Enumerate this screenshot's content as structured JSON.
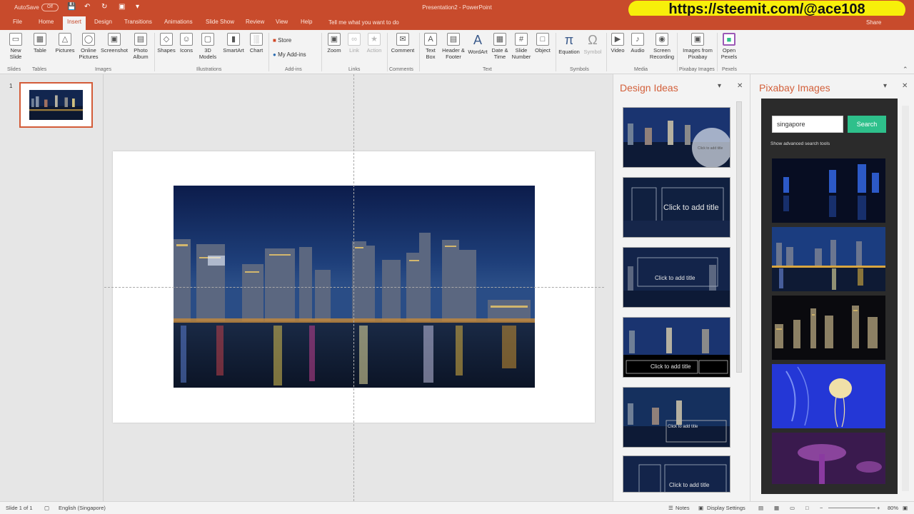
{
  "titlebar": {
    "autosave": "AutoSave",
    "toggle": "Off",
    "title": "Presentation2 - PowerPoint",
    "banner": "https://steemit.com/@ace108"
  },
  "tabs": [
    "File",
    "Home",
    "Insert",
    "Design",
    "Transitions",
    "Animations",
    "Slide Show",
    "Review",
    "View",
    "Help"
  ],
  "active_tab": "Insert",
  "tell_me": "Tell me what you want to do",
  "share": "Share",
  "ribbon": {
    "buttons": {
      "new_slide": "New Slide",
      "table": "Table",
      "pictures": "Pictures",
      "online_pictures": "Online Pictures",
      "screenshot": "Screenshot",
      "photo_album": "Photo Album",
      "shapes": "Shapes",
      "icons": "Icons",
      "models_3d": "3D Models",
      "smartart": "SmartArt",
      "chart": "Chart",
      "store": "Store",
      "my_addins": "My Add-ins",
      "zoom": "Zoom",
      "link": "Link",
      "action": "Action",
      "comment": "Comment",
      "text_box": "Text Box",
      "header_footer": "Header & Footer",
      "wordart": "WordArt",
      "date_time": "Date & Time",
      "slide_number": "Slide Number",
      "object": "Object",
      "equation": "Equation",
      "symbol": "Symbol",
      "video": "Video",
      "audio": "Audio",
      "screen_recording": "Screen Recording",
      "images_from_pixabay": "Images from Pixabay",
      "open_pexels": "Open Pexels"
    },
    "groups": {
      "slides": "Slides",
      "tables": "Tables",
      "images": "Images",
      "illustrations": "Illustrations",
      "addins": "Add-ins",
      "links": "Links",
      "comments": "Comments",
      "text": "Text",
      "symbols": "Symbols",
      "media": "Media",
      "pixabay_images": "Pixabay Images",
      "pexels": "Pexels"
    }
  },
  "thumbnails": {
    "slide_number": "1"
  },
  "design_ideas": {
    "title": "Design Ideas",
    "captions": [
      "Click to add title",
      "Click to add title",
      "Click to add title",
      "Click to add title",
      "Click to add title",
      "Click to add title"
    ]
  },
  "pixabay": {
    "title": "Pixabay Images",
    "search_value": "singapore",
    "search_button": "Search",
    "advanced": "Show advanced search tools"
  },
  "statusbar": {
    "slide_info": "Slide 1 of 1",
    "language": "English (Singapore)",
    "notes": "Notes",
    "display_settings": "Display Settings",
    "zoom": "80%"
  },
  "colors": {
    "accent": "#c84b2c",
    "pane_title": "#d3603b",
    "search_green": "#2ec08b",
    "banner_yellow": "#f7ef0a"
  }
}
